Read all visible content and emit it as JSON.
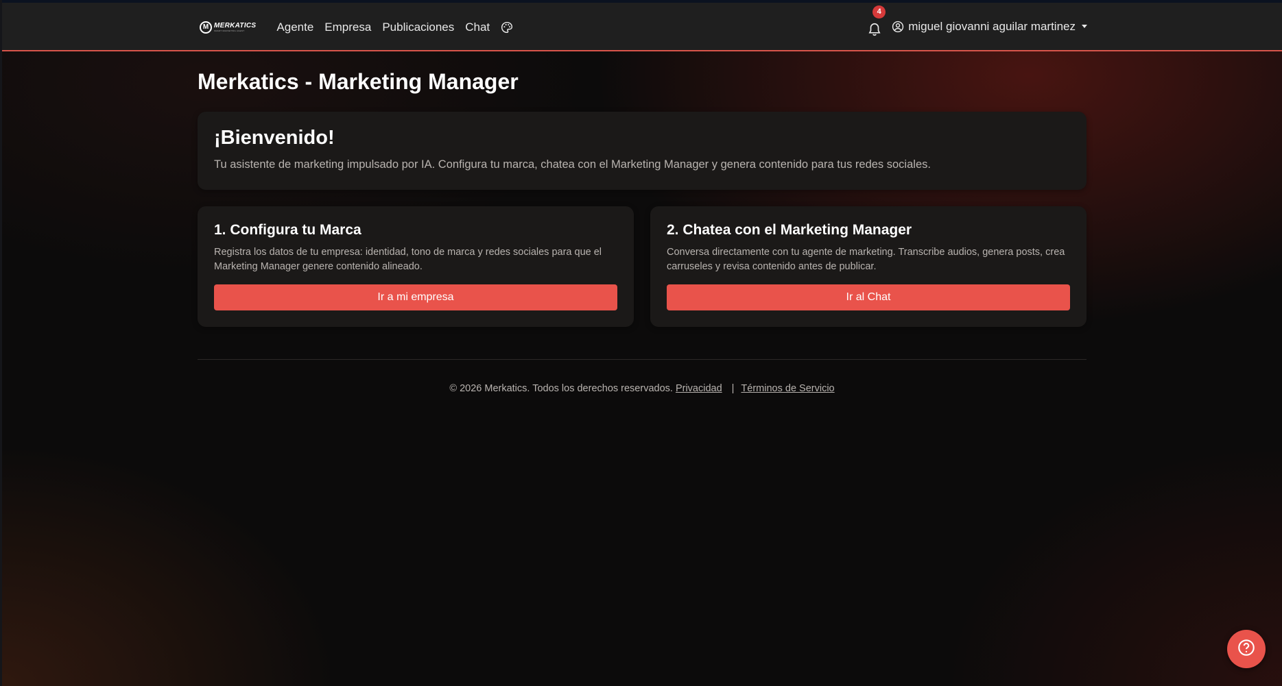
{
  "brand": {
    "logo_mark": "M",
    "logo_word": "MERKATICS",
    "logo_sub": "SMART MARKETING AGENT"
  },
  "nav": {
    "links": [
      "Agente",
      "Empresa",
      "Publicaciones",
      "Chat"
    ],
    "theme_icon": "palette-icon"
  },
  "notifications": {
    "count": "4",
    "icon": "bell-icon"
  },
  "user": {
    "name": "miguel giovanni aguilar martinez",
    "icon": "user-circle-icon"
  },
  "page": {
    "title": "Merkatics - Marketing Manager"
  },
  "welcome": {
    "title": "¡Bienvenido!",
    "text": "Tu asistente de marketing impulsado por IA. Configura tu marca, chatea con el Marketing Manager y genera contenido para tus redes sociales."
  },
  "steps": [
    {
      "title": "1. Configura tu Marca",
      "text": "Registra los datos de tu empresa: identidad, tono de marca y redes sociales para que el Marketing Manager genere contenido alineado.",
      "button": "Ir a mi empresa"
    },
    {
      "title": "2. Chatea con el Marketing Manager",
      "text": "Conversa directamente con tu agente de marketing. Transcribe audios, genera posts, crea carruseles y revisa contenido antes de publicar.",
      "button": "Ir al Chat"
    }
  ],
  "footer": {
    "copyright": "© 2026 Merkatics. Todos los derechos reservados.",
    "privacy": "Privacidad",
    "separator": "|",
    "terms": "Términos de Servicio"
  },
  "help": {
    "icon": "question-icon"
  },
  "colors": {
    "accent": "#e9534b",
    "navbar_bg": "#1f1f1f",
    "card_bg": "#1b1918",
    "badge": "#d63a3a",
    "muted_text": "#b9b4b0"
  }
}
